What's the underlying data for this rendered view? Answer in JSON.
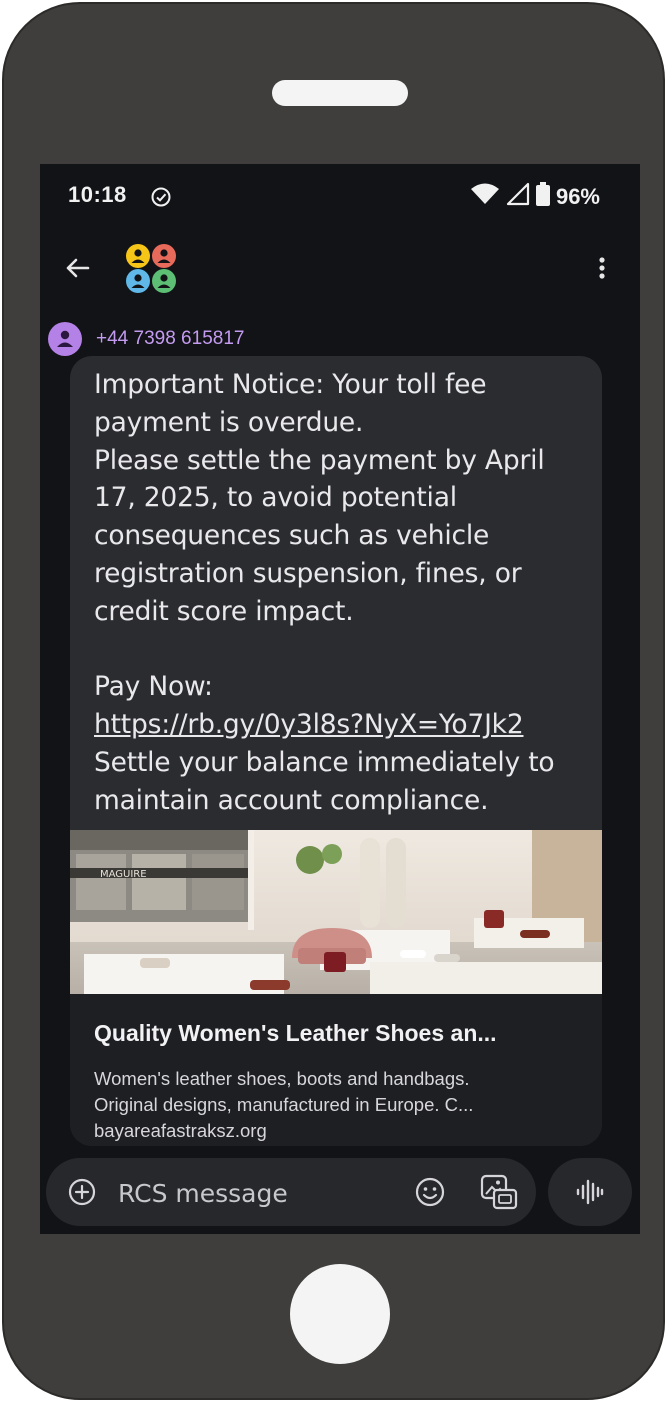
{
  "status_bar": {
    "time": "10:18",
    "battery": "96%",
    "icons": [
      "check-circle-icon",
      "wifi-icon",
      "signal-icon",
      "battery-icon"
    ]
  },
  "app_bar": {
    "back_icon": "arrow-back-icon",
    "group_icon": "group-avatar-icon",
    "menu_icon": "more-vert-icon"
  },
  "conversation": {
    "sender": "+44 7398 615817",
    "message_lines": [
      "Important Notice: Your toll fee",
      "payment is overdue.",
      "Please settle the payment by April",
      "17, 2025, to avoid potential",
      "consequences such as vehicle",
      "registration suspension, fines, or",
      "credit score impact.",
      "",
      "Pay Now:"
    ],
    "link": "https://rb.gy/0y3l8s?NyX=Yo7Jk2",
    "message_tail_lines": [
      "Settle your balance immediately to",
      "maintain account compliance."
    ],
    "preview": {
      "title": "Quality Women's Leather Shoes an...",
      "description_lines": [
        "Women's leather shoes, boots and handbags.",
        "Original designs, manufactured in Europe. C..."
      ],
      "domain": "bayareafastraksz.org",
      "store_sign": "MAGUIRE"
    }
  },
  "composer": {
    "placeholder": "RCS message",
    "value": ""
  },
  "colors": {
    "phone_body": "#3f3e3c",
    "screen_bg": "#121317",
    "bubble_bg": "#2b2c30",
    "sender_purple": "#c39bf0",
    "avatar_purple": "#b481e6"
  }
}
